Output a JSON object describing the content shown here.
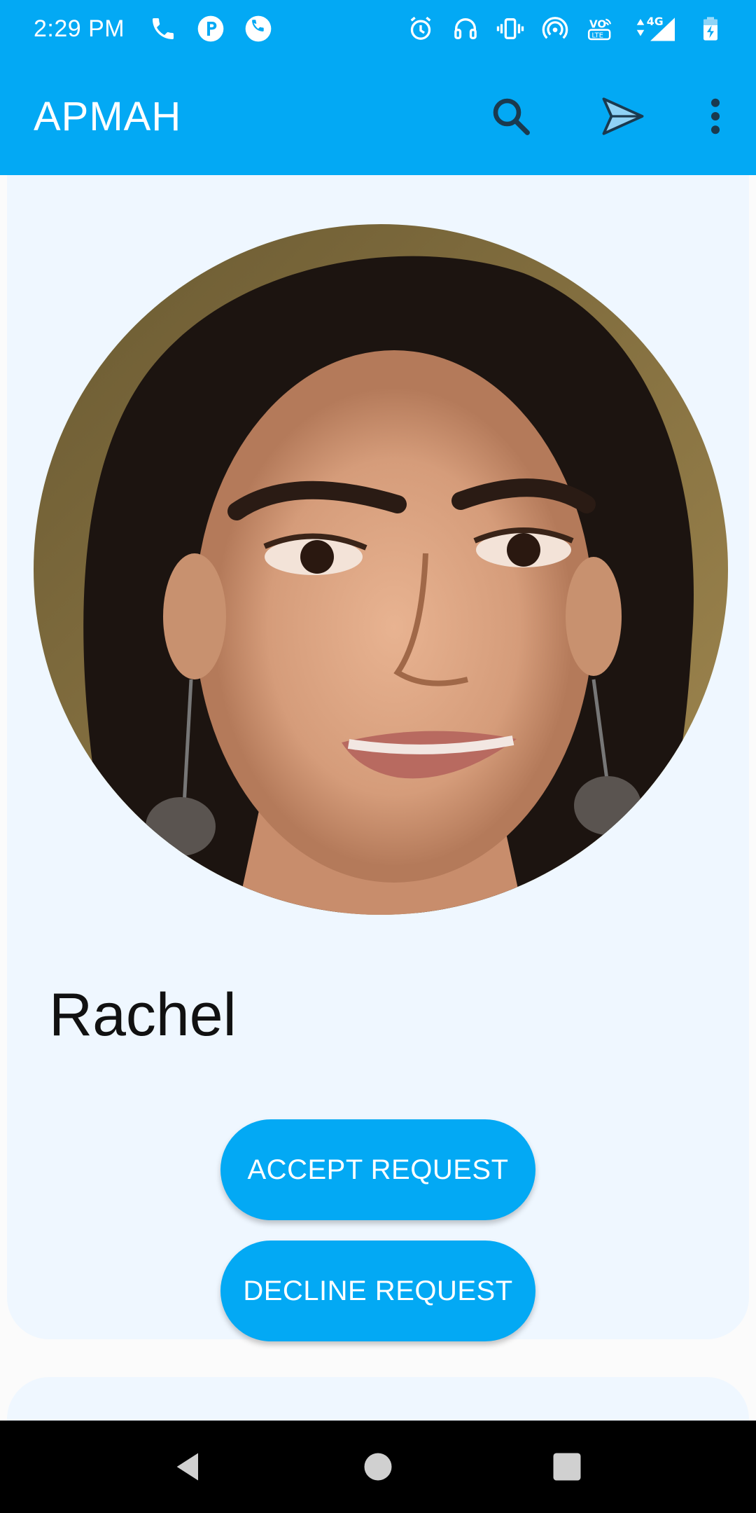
{
  "status_bar": {
    "time": "2:29 PM",
    "network": "4G",
    "left_icons": [
      "phone-icon",
      "paytm-icon",
      "whatsapp-icon"
    ],
    "right_icons": [
      "alarm-icon",
      "headset-icon",
      "vibrate-icon",
      "hotspot-icon",
      "volte-icon",
      "signal-icon",
      "battery-charging-icon"
    ]
  },
  "app_bar": {
    "title": "APMAH",
    "actions": [
      "search-icon",
      "send-icon",
      "more-vert-icon"
    ]
  },
  "profile": {
    "name": "Rachel",
    "accept_label": "ACCEPT REQUEST",
    "decline_label": "DECLINE REQUEST"
  },
  "nav_bar": {
    "buttons": [
      "back-icon",
      "home-icon",
      "recents-icon"
    ]
  },
  "colors": {
    "primary": "#03a9f4",
    "card_background": "#eff7ff",
    "nav_background": "#000000"
  }
}
